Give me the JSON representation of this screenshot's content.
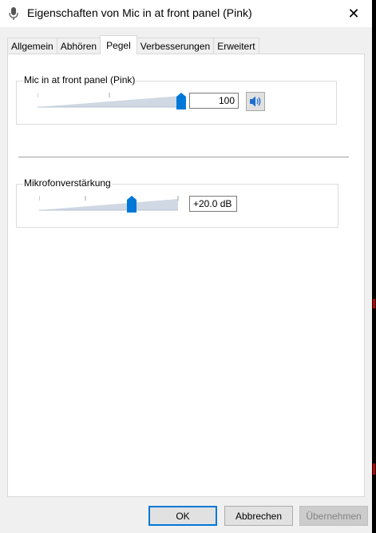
{
  "window": {
    "title": "Eigenschaften von Mic in at front panel (Pink)",
    "close_glyph": "✕"
  },
  "tabs": [
    {
      "label": "Allgemein",
      "active": false
    },
    {
      "label": "Abhören",
      "active": false
    },
    {
      "label": "Pegel",
      "active": true
    },
    {
      "label": "Verbesserungen",
      "active": false
    },
    {
      "label": "Erweitert",
      "active": false
    }
  ],
  "level": {
    "label": "Mic in at front panel (Pink)",
    "value_text": "100",
    "slider_value": 100,
    "slider_max": 100,
    "speaker_icon": "speaker-icon"
  },
  "boost": {
    "label": "Mikrofonverstärkung",
    "value_text": "+20.0 dB",
    "slider_fraction": 0.667
  },
  "buttons": {
    "ok": "OK",
    "cancel": "Abbrechen",
    "apply": "Übernehmen"
  },
  "colors": {
    "accent": "#0078d7",
    "slider_track": "#cfd8e3"
  }
}
